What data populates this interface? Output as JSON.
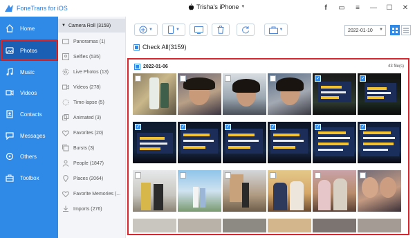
{
  "app": {
    "title": "FoneTrans for iOS",
    "device": "Trisha's iPhone"
  },
  "window_buttons": [
    {
      "icon": "facebook-icon",
      "glyph": "f"
    },
    {
      "icon": "feedback-icon",
      "glyph": "▭"
    },
    {
      "icon": "menu-icon",
      "glyph": "≡"
    },
    {
      "icon": "minimize-icon",
      "glyph": "—"
    },
    {
      "icon": "maximize-icon",
      "glyph": "☐"
    },
    {
      "icon": "close-icon",
      "glyph": "✕"
    }
  ],
  "sidebar": {
    "items": [
      {
        "label": "Home",
        "icon": "home-icon"
      },
      {
        "label": "Photos",
        "icon": "photos-icon",
        "active": true
      },
      {
        "label": "Music",
        "icon": "music-icon"
      },
      {
        "label": "Videos",
        "icon": "videos-icon"
      },
      {
        "label": "Contacts",
        "icon": "contacts-icon"
      },
      {
        "label": "Messages",
        "icon": "messages-icon"
      },
      {
        "label": "Others",
        "icon": "others-icon"
      },
      {
        "label": "Toolbox",
        "icon": "toolbox-icon"
      }
    ]
  },
  "albums": {
    "header": "Camera Roll (3159)",
    "items": [
      {
        "label": "Panoramas (1)"
      },
      {
        "label": "Selfies (535)"
      },
      {
        "label": "Live Photos (13)"
      },
      {
        "label": "Videos (278)"
      },
      {
        "label": "Time-lapse (5)"
      },
      {
        "label": "Animated (3)"
      },
      {
        "label": "Favorites (20)"
      },
      {
        "label": "Bursts (3)"
      },
      {
        "label": "People (1847)"
      },
      {
        "label": "Places (2064)"
      },
      {
        "label": "Favorite Memories (..."
      },
      {
        "label": "Imports (276)"
      }
    ]
  },
  "toolbar": {
    "date": "2022-01-10",
    "buttons": [
      "add-icon",
      "export-to-device-icon",
      "export-to-pc-icon",
      "delete-icon",
      "refresh-icon",
      "more-toolbox-icon"
    ]
  },
  "content": {
    "check_all": "Check All(3159)",
    "group_date": "2022-01-06",
    "file_count": "43 file(s)"
  },
  "colors": {
    "accent": "#2e8ae6",
    "highlight": "#d7262e",
    "sidebar_active": "#1a5fb3"
  }
}
